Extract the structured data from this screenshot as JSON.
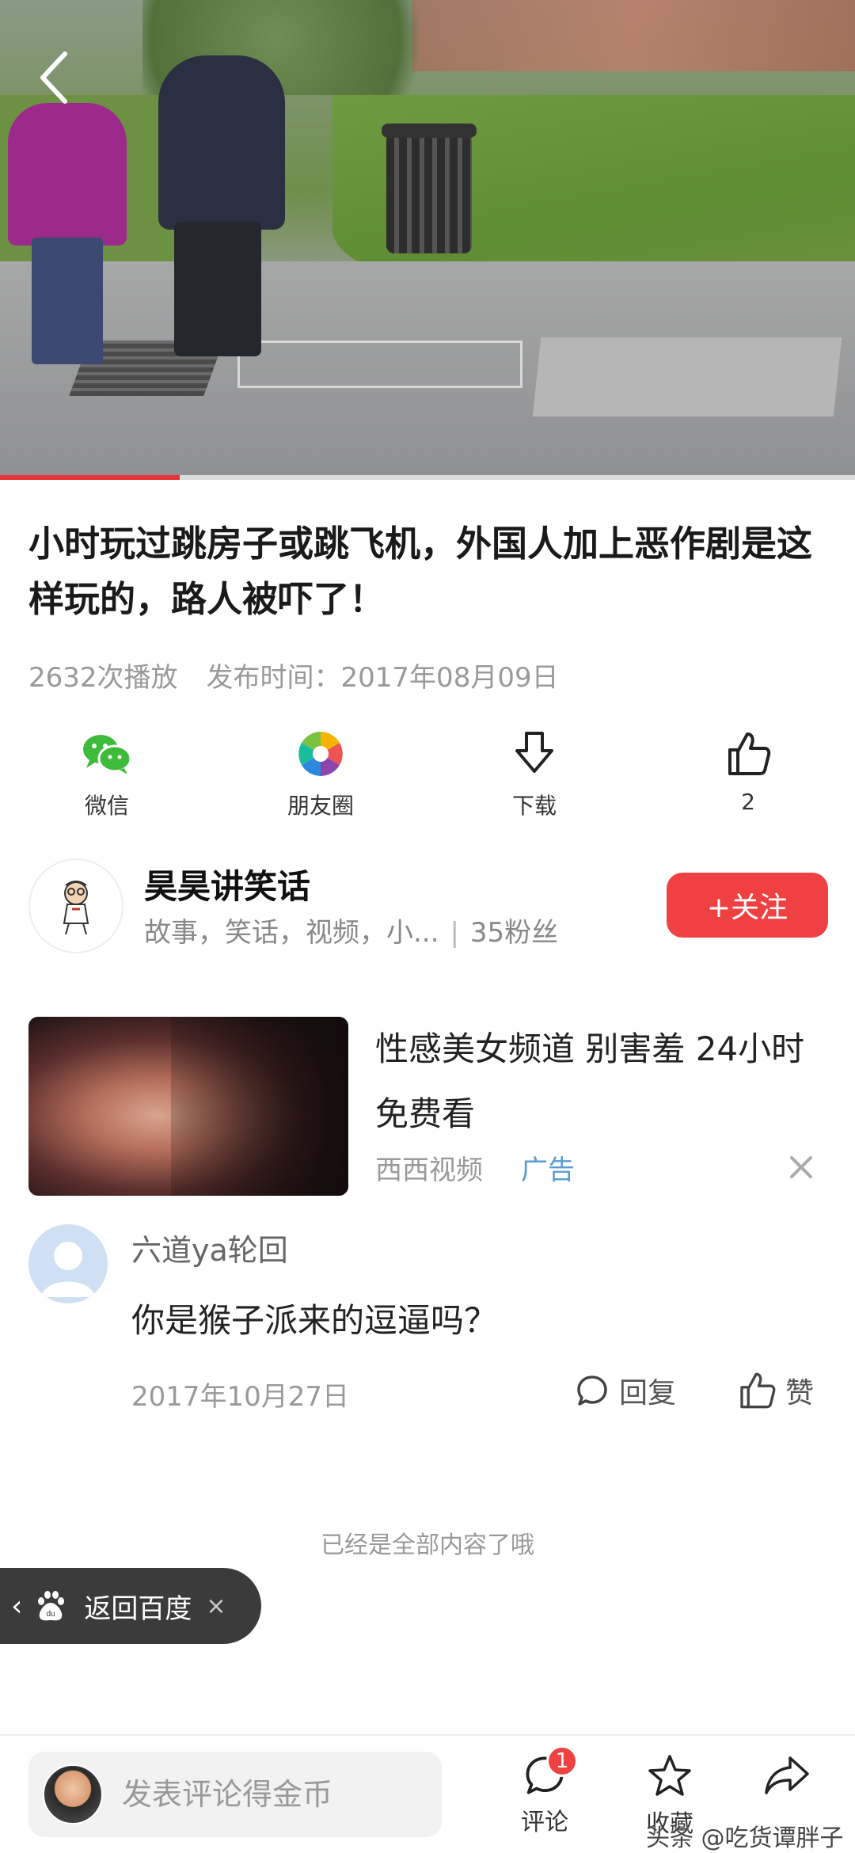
{
  "video": {
    "progress": 0.21
  },
  "article": {
    "title": "小时玩过跳房子或跳飞机，外国人加上恶作剧是这样玩的，路人被吓了！",
    "plays": "2632次播放",
    "publish_time": "发布时间：2017年08月09日"
  },
  "share": {
    "wechat": "微信",
    "moments": "朋友圈",
    "download": "下载",
    "likes": "2"
  },
  "author": {
    "name": "昊昊讲笑话",
    "desc": "故事，笑话，视频，小...",
    "sep": "|",
    "fans": "35粉丝",
    "follow_label": "+关注"
  },
  "ad": {
    "title": "性感美女频道 别害羞 24小时免费看",
    "source": "西西视频",
    "tag": "广告"
  },
  "comment": {
    "user": "六道ya轮回",
    "text": "你是猴子派来的逗逼吗？",
    "date": "2017年10月27日",
    "reply_label": "回复",
    "like_label": "赞"
  },
  "end_note": "已经是全部内容了哦",
  "baidu_pill": {
    "label": "返回百度",
    "close": "×"
  },
  "bottom_bar": {
    "comment_placeholder": "发表评论得金币",
    "comment_label": "评论",
    "comment_count": "1",
    "favorite_label": "收藏",
    "watermark": "头条 @吃货谭胖子"
  },
  "colors": {
    "accent": "#f04142",
    "tag_blue": "#5b9bd5",
    "wechat_green": "#3dbb3a"
  }
}
